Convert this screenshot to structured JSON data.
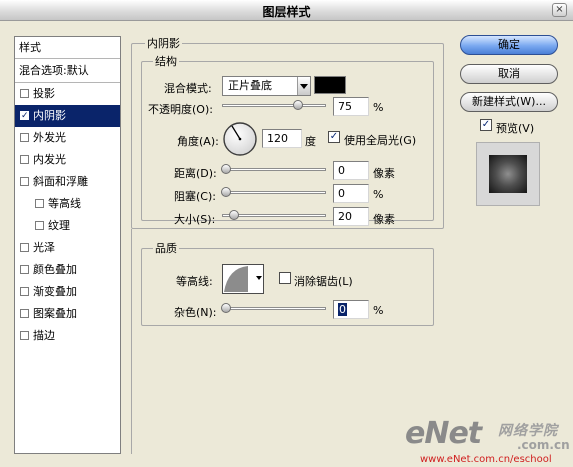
{
  "dialog": {
    "title": "图层样式",
    "close_label": "×"
  },
  "left_list": {
    "header": "样式",
    "blend_default": "混合选项:默认",
    "items": [
      {
        "label": "投影",
        "checked": false,
        "indent": false,
        "selected": false
      },
      {
        "label": "内阴影",
        "checked": true,
        "indent": false,
        "selected": true
      },
      {
        "label": "外发光",
        "checked": false,
        "indent": false,
        "selected": false
      },
      {
        "label": "内发光",
        "checked": false,
        "indent": false,
        "selected": false
      },
      {
        "label": "斜面和浮雕",
        "checked": false,
        "indent": false,
        "selected": false
      },
      {
        "label": "等高线",
        "checked": false,
        "indent": true,
        "selected": false
      },
      {
        "label": "纹理",
        "checked": false,
        "indent": true,
        "selected": false
      },
      {
        "label": "光泽",
        "checked": false,
        "indent": false,
        "selected": false
      },
      {
        "label": "颜色叠加",
        "checked": false,
        "indent": false,
        "selected": false
      },
      {
        "label": "渐变叠加",
        "checked": false,
        "indent": false,
        "selected": false
      },
      {
        "label": "图案叠加",
        "checked": false,
        "indent": false,
        "selected": false
      },
      {
        "label": "描边",
        "checked": false,
        "indent": false,
        "selected": false
      }
    ]
  },
  "inner_shadow": {
    "section_title": "内阴影",
    "structure_title": "结构",
    "blend_mode_label": "混合模式:",
    "blend_mode_value": "正片叠底",
    "shadow_color": "#000000",
    "opacity_label": "不透明度(O):",
    "opacity_value": "75",
    "opacity_level": 75,
    "opacity_unit": "%",
    "angle_label": "角度(A):",
    "angle_value": "120",
    "angle_unit": "度",
    "global_light_label": "使用全局光(G)",
    "global_light_checked": true,
    "distance_label": "距离(D):",
    "distance_value": "0",
    "distance_level": 0,
    "distance_unit": "像素",
    "choke_label": "阻塞(C):",
    "choke_value": "0",
    "choke_level": 0,
    "choke_unit": "%",
    "size_label": "大小(S):",
    "size_value": "20",
    "size_level": 8,
    "size_unit": "像素"
  },
  "quality": {
    "title": "品质",
    "contour_label": "等高线:",
    "anti_alias_label": "消除锯齿(L)",
    "anti_alias_checked": false,
    "noise_label": "杂色(N):",
    "noise_value": "0",
    "noise_level": 0,
    "noise_unit": "%"
  },
  "buttons": {
    "ok": "确定",
    "cancel": "取消",
    "new_style": "新建样式(W)...",
    "preview_label": "预览(V)",
    "preview_checked": true
  },
  "watermark": {
    "brand": "eNet",
    "side_text": "网络学院",
    "dotcom": ".com.cn",
    "url": "www.eNet.com.cn/eschool"
  },
  "colors": {
    "dialog_bg": "#ece9d8",
    "selection": "#0a246a",
    "primary_button": "#79a8f0",
    "watermark_url": "#d01e1e"
  }
}
